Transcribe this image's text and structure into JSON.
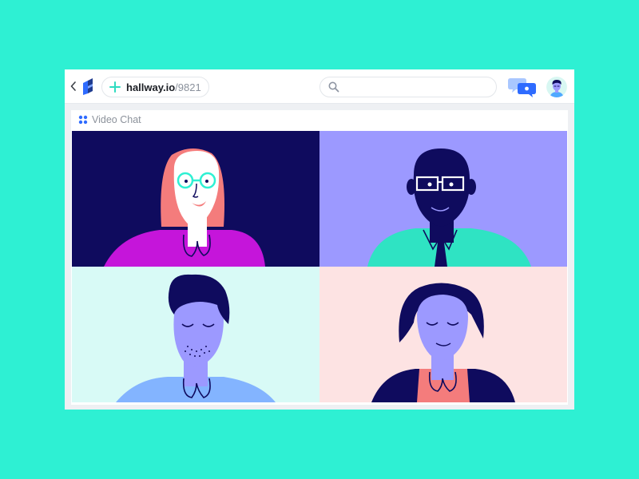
{
  "app": {
    "background_color": "#2EF0D3"
  },
  "topbar": {
    "back_icon": "chevron-left-icon",
    "logo_icon": "hallway-logo-icon",
    "add_icon": "plus-icon",
    "url_domain": "hallway.io",
    "url_path": "/9821",
    "search_icon": "search-icon",
    "search_value": "",
    "search_placeholder": "",
    "chat_icon": "chat-bubbles-icon",
    "avatar_icon": "user-avatar-icon"
  },
  "panel": {
    "icon": "grid-icon",
    "title": "Video Chat"
  },
  "participants": [
    {
      "tile": "top-left",
      "background": "#0F0B5E",
      "description": "woman with glasses"
    },
    {
      "tile": "top-right",
      "background": "#9C99FF",
      "description": "man with glasses and tie"
    },
    {
      "tile": "bottom-left",
      "background": "#D8FAF6",
      "description": "man with quiff and stubble"
    },
    {
      "tile": "bottom-right",
      "background": "#FDE3E3",
      "description": "woman with bob haircut"
    }
  ],
  "colors": {
    "accent": "#2E6BFF",
    "teal": "#2EF0D3",
    "navy": "#0F0B5E"
  }
}
